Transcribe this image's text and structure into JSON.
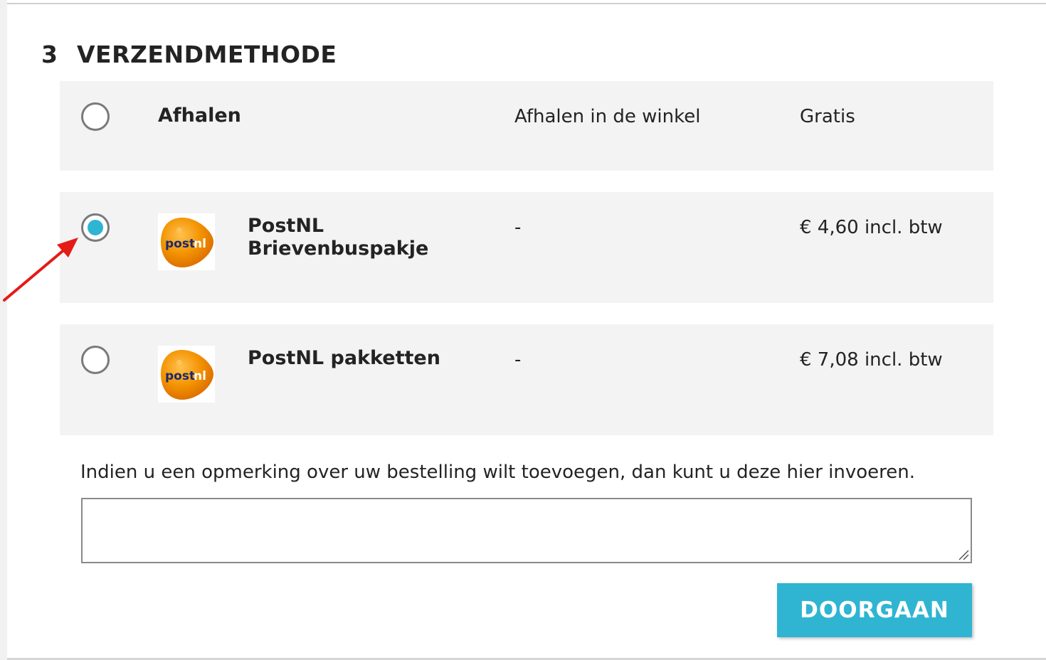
{
  "step": {
    "number": "3",
    "title": "VERZENDMETHODE"
  },
  "delivery_options": [
    {
      "name": "Afhalen",
      "delay": "Afhalen in de winkel",
      "price": "Gratis",
      "selected": false,
      "has_logo": false
    },
    {
      "name_line1": "PostNL",
      "name_line2": "Brievenbuspakje",
      "delay": "-",
      "price": "€ 4,60 incl. btw",
      "selected": true,
      "has_logo": true,
      "logo_icon": "postnl-logo-icon"
    },
    {
      "name": "PostNL pakketten",
      "delay": "-",
      "price": "€ 7,08 incl. btw",
      "selected": false,
      "has_logo": true,
      "logo_icon": "postnl-logo-icon"
    }
  ],
  "logo_text": {
    "post": "post",
    "nl": "nl"
  },
  "comment": {
    "label": "Indien u een opmerking over uw bestelling wilt toevoegen, dan kunt u deze hier invoeren.",
    "value": ""
  },
  "continue_button": {
    "label": "DOORGAAN"
  },
  "colors": {
    "accent": "#2fb5d2",
    "option_background": "#f3f3f3",
    "annotation_arrow": "#e41b17",
    "postnl_orange": "#f39200"
  }
}
